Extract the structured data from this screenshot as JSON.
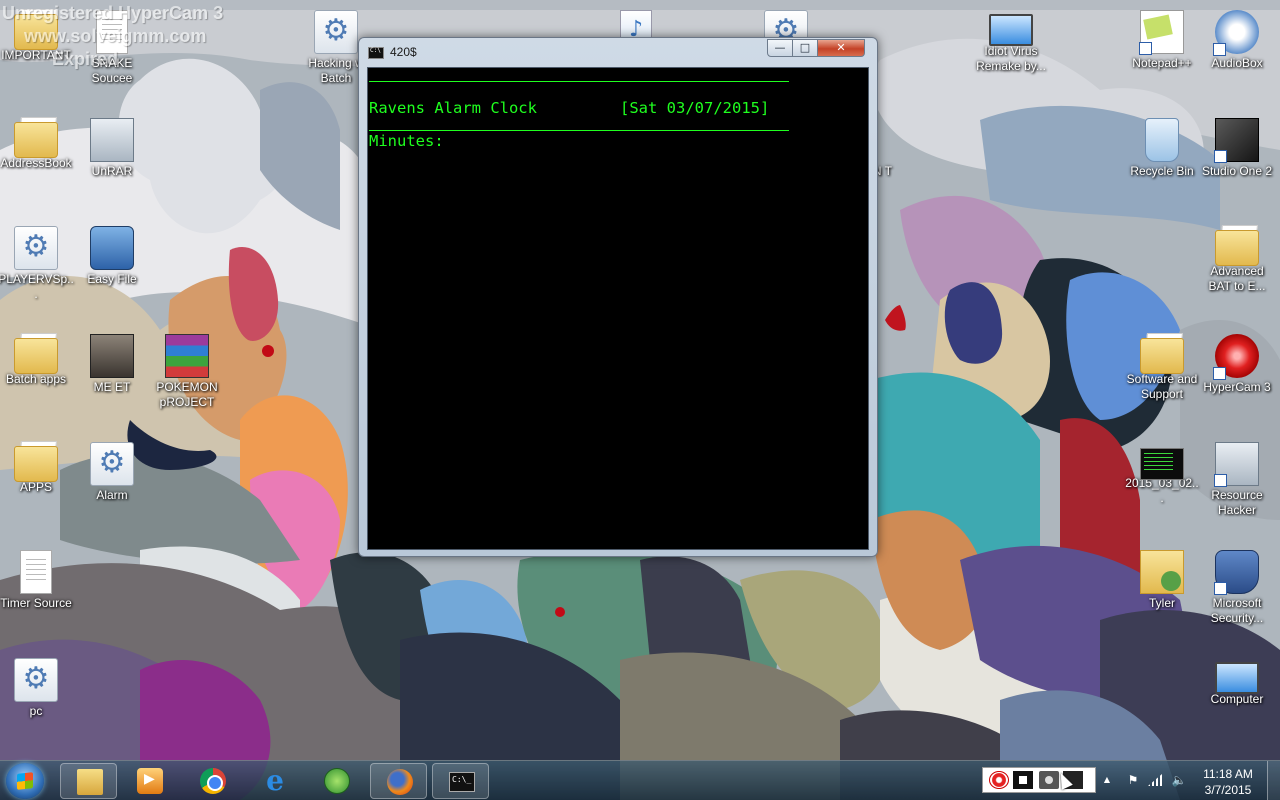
{
  "watermark": {
    "line1": "Unregistered HyperCam 3",
    "line2": "www.solveigmm.com",
    "line3": "Unregistered HyperCam 3 – License Expired",
    "line3_visible": "Expired"
  },
  "desktop_icons": [
    {
      "label": "IMPORTANT",
      "icon": "folder-icon"
    },
    {
      "label": "SNAKE Soucee",
      "icon": "document-icon"
    },
    {
      "label": "Hacking w Batch",
      "icon": "batch-file-icon"
    },
    {
      "label": "",
      "icon": "audio-file-icon"
    },
    {
      "label": "",
      "icon": "batch-file-icon"
    },
    {
      "label": "Idiot Virus Remake by...",
      "icon": "screen-icon"
    },
    {
      "label": "Notepad++",
      "icon": "notepad-icon"
    },
    {
      "label": "AudioBox",
      "icon": "usb-icon"
    },
    {
      "label": "AddressBook",
      "icon": "folder-icon"
    },
    {
      "label": "UnRAR",
      "icon": "window-icon"
    },
    {
      "label": "Recycle Bin",
      "icon": "recycle-bin-icon"
    },
    {
      "label": "Studio One 2",
      "icon": "studio-one-icon"
    },
    {
      "label": "PLAYERVSp...",
      "icon": "batch-file-icon"
    },
    {
      "label": "Easy File",
      "icon": "computer-icon"
    },
    {
      "label": "Advanced BAT to E...",
      "icon": "folder-icon"
    },
    {
      "label": "Batch apps",
      "icon": "folder-icon"
    },
    {
      "label": "ME ET",
      "icon": "photo-icon"
    },
    {
      "label": "POKEMON pROJECT",
      "icon": "winrar-icon"
    },
    {
      "label": "Software and Support",
      "icon": "folder-icon"
    },
    {
      "label": "HyperCam 3",
      "icon": "record-icon"
    },
    {
      "label": "APPS",
      "icon": "folder-icon"
    },
    {
      "label": "Alarm",
      "icon": "batch-file-icon"
    },
    {
      "label": "2015_03_02...",
      "icon": "terminal-screenshot-icon"
    },
    {
      "label": "Resource Hacker",
      "icon": "tools-icon"
    },
    {
      "label": "Timer Source",
      "icon": "document-icon"
    },
    {
      "label": "Tyler",
      "icon": "user-folder-icon"
    },
    {
      "label": "Microsoft Security...",
      "icon": "shield-icon"
    },
    {
      "label": "pc",
      "icon": "batch-file-icon"
    },
    {
      "label": "Computer",
      "icon": "computer-icon"
    },
    {
      "label": "ON T",
      "icon": "partially-hidden-icon"
    }
  ],
  "console_window": {
    "title": "420$",
    "minimize_label": "—",
    "maximize_label": "□",
    "close_label": "✕",
    "app_title": "Ravens Alarm Clock",
    "date": "[Sat 03/07/2015]",
    "prompt": "Minutes:",
    "text_color": "#1fff1f",
    "background_color": "#000000"
  },
  "taskbar": {
    "pinned": [
      {
        "name": "Windows Explorer",
        "icon": "folder-icon"
      },
      {
        "name": "Windows Media Player",
        "icon": "media-player-icon"
      },
      {
        "name": "Google Chrome",
        "icon": "chrome-icon"
      },
      {
        "name": "Internet Explorer",
        "icon": "ie-icon",
        "glyph": "e"
      },
      {
        "name": "Globe app",
        "icon": "globe-icon"
      },
      {
        "name": "Firefox",
        "icon": "firefox-icon"
      },
      {
        "name": "Command Prompt",
        "icon": "cmd-icon"
      }
    ],
    "clock": {
      "time": "11:18 AM",
      "date": "3/7/2015"
    },
    "tray": {
      "chevron": "▲",
      "flag": "⚑",
      "volume": "🔈"
    }
  }
}
